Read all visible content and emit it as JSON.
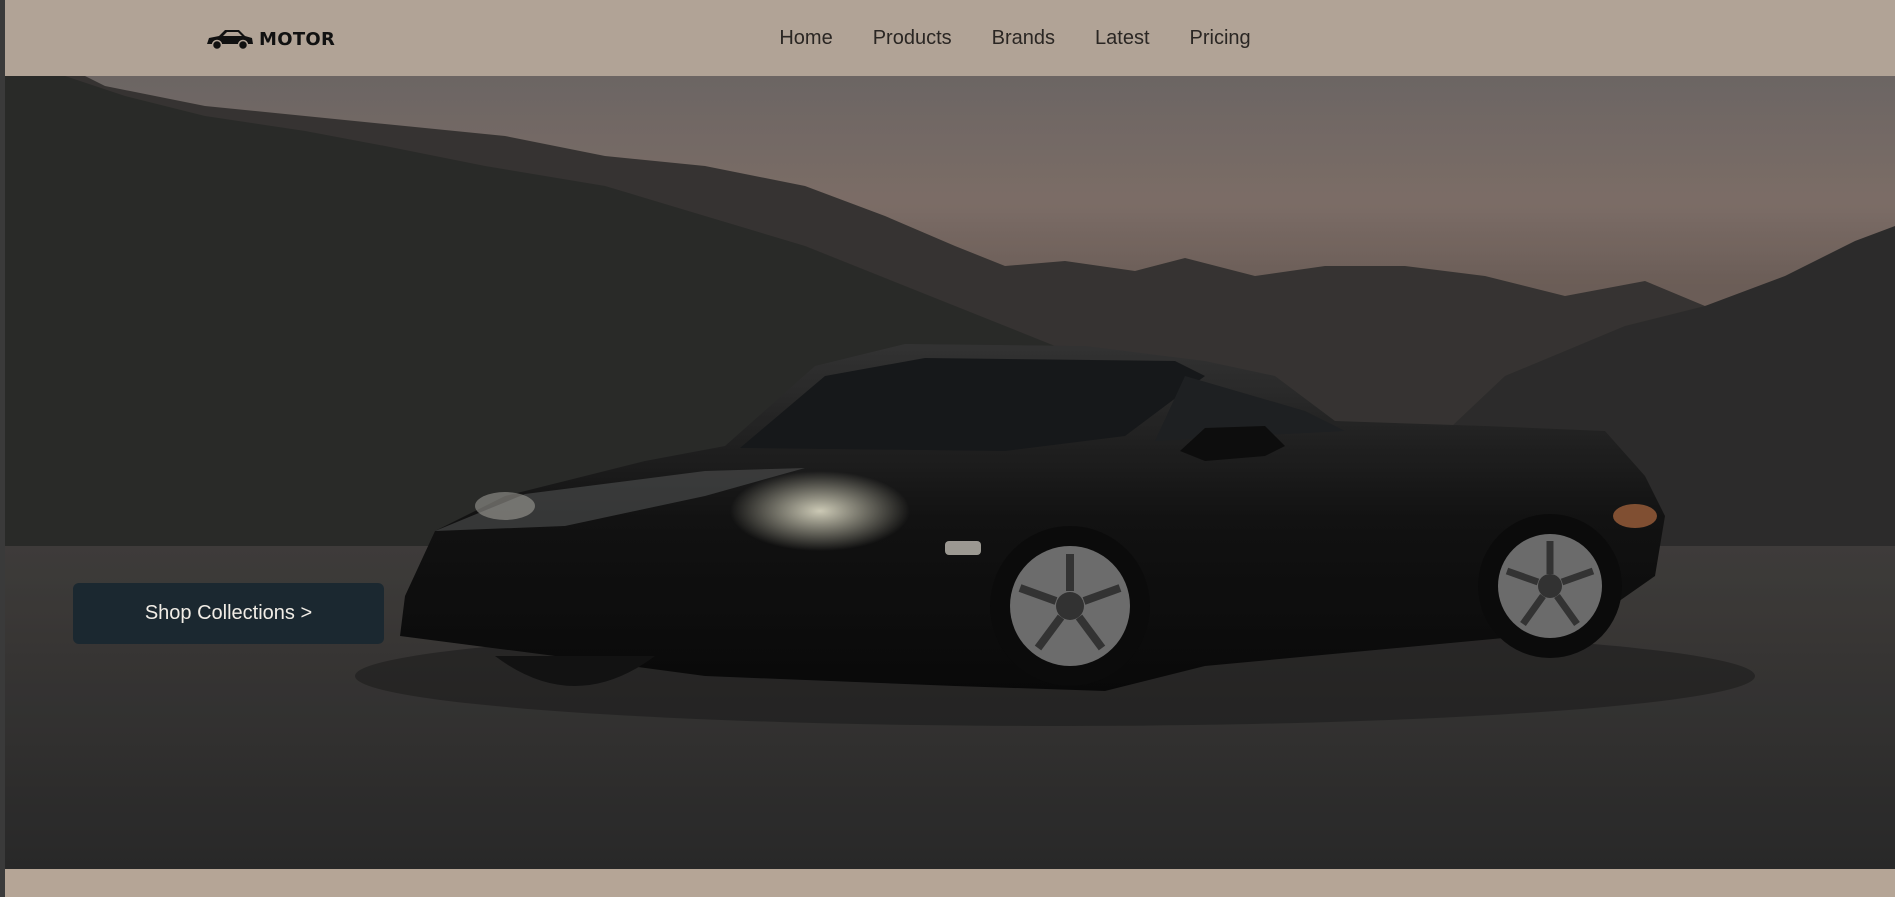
{
  "header": {
    "logo_text": "MOTOR",
    "logo_icon": "car-icon"
  },
  "nav": {
    "items": [
      {
        "label": "Home"
      },
      {
        "label": "Products"
      },
      {
        "label": "Brands"
      },
      {
        "label": "Latest"
      },
      {
        "label": "Pricing"
      }
    ]
  },
  "hero": {
    "cta_label": "Shop Collections >",
    "image_subject": "black sports car at dusk in front of hills"
  },
  "colors": {
    "navbar_bg": "#b1a396",
    "cta_bg": "#1b2830",
    "cta_text": "#f1ede6",
    "nav_text": "#2a2623"
  }
}
